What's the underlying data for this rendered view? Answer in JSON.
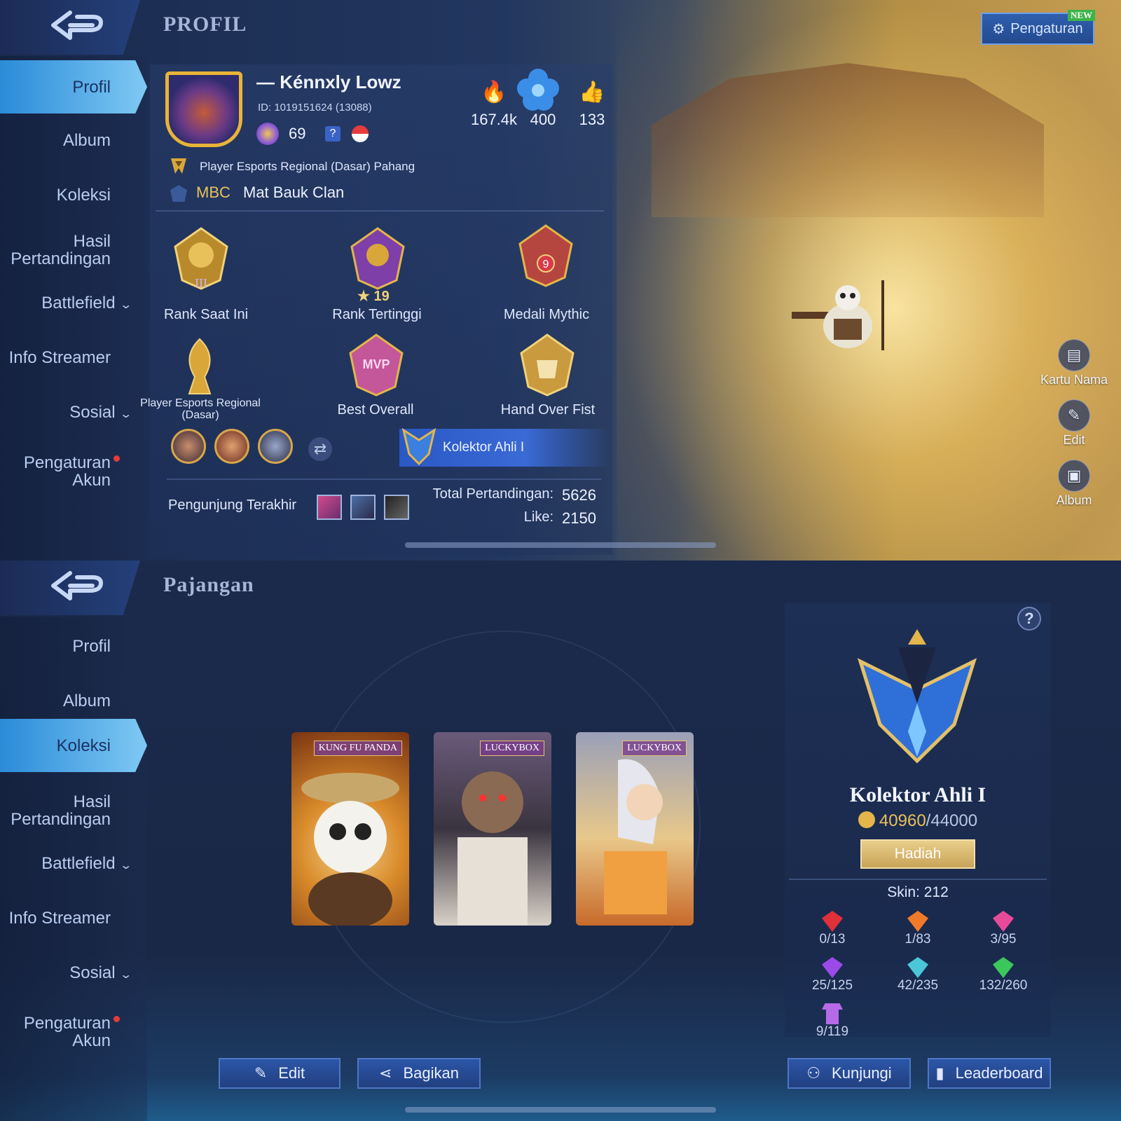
{
  "panel1": {
    "title": "PROFIL",
    "sidebar": [
      {
        "label": "Profil",
        "active": true
      },
      {
        "label": "Album"
      },
      {
        "label": "Koleksi"
      },
      {
        "label": "Hasil Pertandingan"
      },
      {
        "label": "Battlefield",
        "chevron": true
      },
      {
        "label": "Info Streamer"
      },
      {
        "label": "Sosial",
        "chevron": true
      },
      {
        "label": "Pengaturan Akun",
        "dot": true
      }
    ],
    "settings_label": "Pengaturan",
    "new_tag": "NEW",
    "player": {
      "name": "— Kénnxly Lowz",
      "id": "ID:  1019151624 (13088)",
      "level": "69",
      "unknown_badge": "?",
      "esports_title": "Player Esports Regional (Dasar) Pahang",
      "clan_tag": "MBC",
      "clan_name": "Mat Bauk Clan"
    },
    "stats": [
      {
        "icon": "fire-icon",
        "value": "167.4k"
      },
      {
        "icon": "flower-icon",
        "value": "400"
      },
      {
        "icon": "thumbs-up-icon",
        "value": "133"
      }
    ],
    "badges": [
      {
        "label": "Rank Saat Ini",
        "sub": "III"
      },
      {
        "label": "Rank Tertinggi",
        "sub": "★ 19"
      },
      {
        "label": "Medali Mythic",
        "sub": "9"
      },
      {
        "label": "Player Esports Regional (Dasar)"
      },
      {
        "label": "Best Overall",
        "sub": "MVP"
      },
      {
        "label": "Hand Over Fist"
      }
    ],
    "collector_banner": "Kolektor Ahli I",
    "visitors_label": "Pengunjung Terakhir",
    "total_matches_label": "Total Pertandingan:",
    "total_matches": "5626",
    "like_label": "Like:",
    "like_value": "2150",
    "side_actions": [
      {
        "label": "Kartu Nama",
        "icon": "card-icon"
      },
      {
        "label": "Edit",
        "icon": "edit-hero-icon"
      },
      {
        "label": "Album",
        "icon": "image-icon"
      }
    ]
  },
  "panel2": {
    "title": "Pajangan",
    "sidebar": [
      {
        "label": "Profil"
      },
      {
        "label": "Album"
      },
      {
        "label": "Koleksi",
        "active": true
      },
      {
        "label": "Hasil Pertandingan"
      },
      {
        "label": "Battlefield",
        "chevron": true
      },
      {
        "label": "Info Streamer"
      },
      {
        "label": "Sosial",
        "chevron": true
      },
      {
        "label": "Pengaturan Akun",
        "dot": true
      }
    ],
    "cards": [
      {
        "tag": "KUNG FU PANDA"
      },
      {
        "tag": "LUCKYBOX"
      },
      {
        "tag": "LUCKYBOX"
      }
    ],
    "collector": {
      "title": "Kolektor Ahli I",
      "progress": "40960",
      "progress_max": "/44000",
      "reward_button": "Hadiah",
      "skin": "Skin: 212",
      "gems": [
        "0/13",
        "1/83",
        "3/95",
        "25/125",
        "42/235",
        "132/260",
        "9/119"
      ],
      "help": "?"
    },
    "buttons": {
      "edit": "Edit",
      "share": "Bagikan",
      "visit": "Kunjungi",
      "leaderboard": "Leaderboard"
    }
  },
  "colors": {
    "accent": "#3a6ad6",
    "gold": "#e8c15a",
    "active_tab": "#7fc9f4"
  }
}
